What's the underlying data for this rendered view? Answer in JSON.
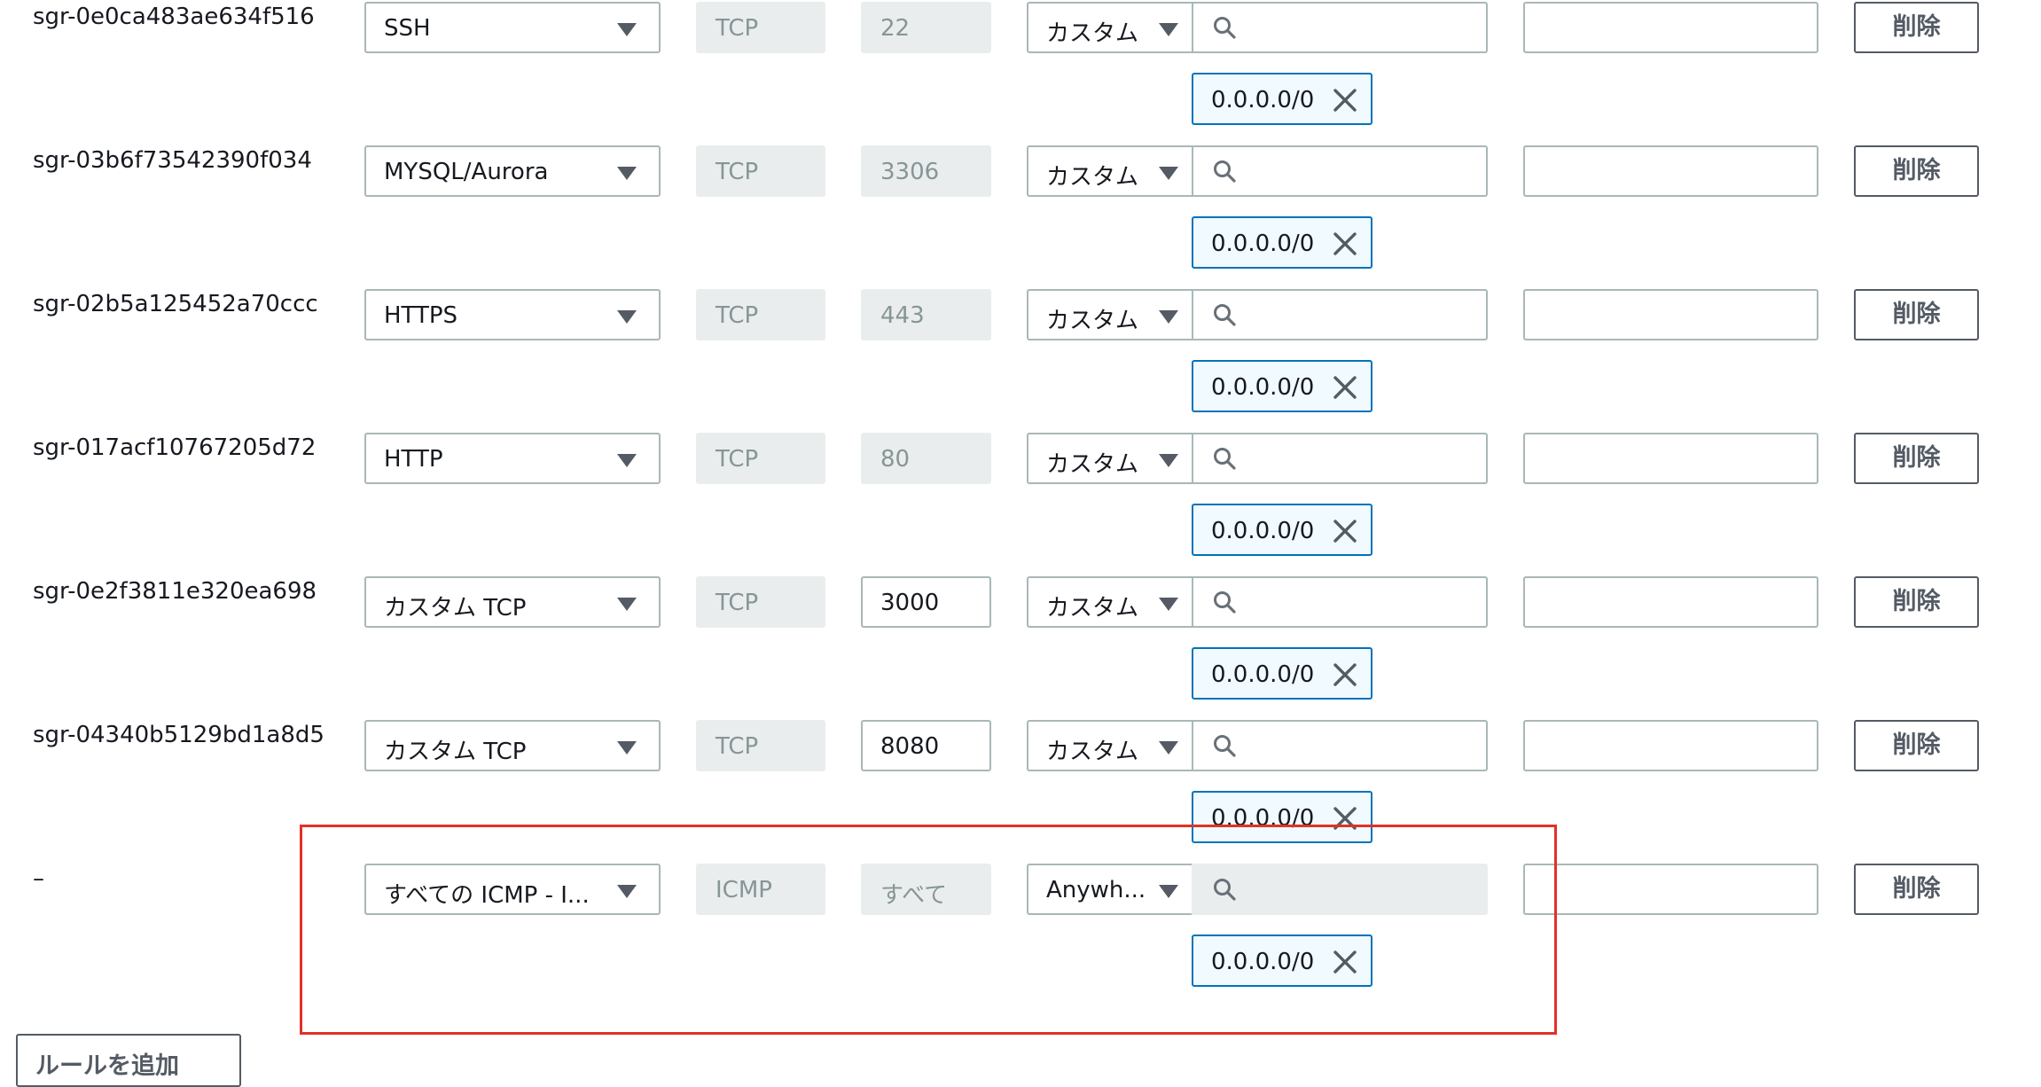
{
  "delete_label": "削除",
  "add_rule_label": "ルールを追加",
  "rules": [
    {
      "id": "sgr-0e0ca483ae634f516",
      "type": "SSH",
      "protocol": "TCP",
      "port": "22",
      "port_editable": false,
      "source_type": "カスタム",
      "search_disabled": false,
      "cidr": "0.0.0.0/0"
    },
    {
      "id": "sgr-03b6f73542390f034",
      "type": "MYSQL/Aurora",
      "protocol": "TCP",
      "port": "3306",
      "port_editable": false,
      "source_type": "カスタム",
      "search_disabled": false,
      "cidr": "0.0.0.0/0"
    },
    {
      "id": "sgr-02b5a125452a70ccc",
      "type": "HTTPS",
      "protocol": "TCP",
      "port": "443",
      "port_editable": false,
      "source_type": "カスタム",
      "search_disabled": false,
      "cidr": "0.0.0.0/0"
    },
    {
      "id": "sgr-017acf10767205d72",
      "type": "HTTP",
      "protocol": "TCP",
      "port": "80",
      "port_editable": false,
      "source_type": "カスタム",
      "search_disabled": false,
      "cidr": "0.0.0.0/0"
    },
    {
      "id": "sgr-0e2f3811e320ea698",
      "type": "カスタム TCP",
      "protocol": "TCP",
      "port": "3000",
      "port_editable": true,
      "source_type": "カスタム",
      "search_disabled": false,
      "cidr": "0.0.0.0/0"
    },
    {
      "id": "sgr-04340b5129bd1a8d5",
      "type": "カスタム TCP",
      "protocol": "TCP",
      "port": "8080",
      "port_editable": true,
      "source_type": "カスタム",
      "search_disabled": false,
      "cidr": "0.0.0.0/0"
    },
    {
      "id": "–",
      "type": "すべての ICMP - I...",
      "protocol": "ICMP",
      "port": "すべて",
      "port_editable": false,
      "source_type": "Anywh...",
      "search_disabled": true,
      "cidr": "0.0.0.0/0"
    }
  ],
  "colors": {
    "highlight": "#e33027",
    "token_border": "#0073bb",
    "token_bg": "#f1faff"
  },
  "icons": {
    "dropdown": "caret-down-icon",
    "search": "search-icon",
    "remove": "close-icon"
  }
}
